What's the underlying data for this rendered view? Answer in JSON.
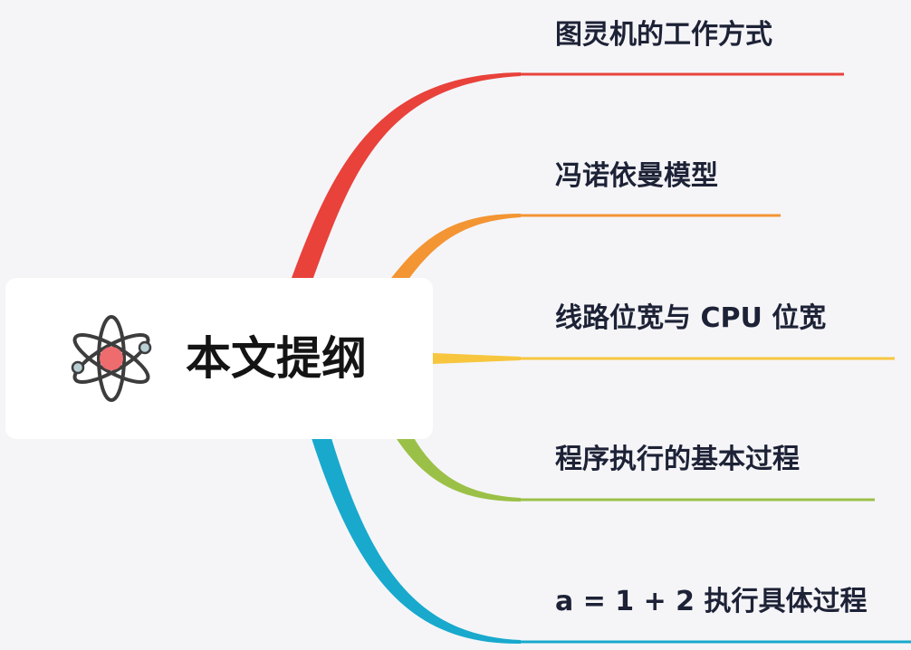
{
  "root": {
    "title": "本文提纲",
    "icon": "atom-icon"
  },
  "topics": [
    {
      "label": "图灵机的工作方式",
      "color": "#e8423b"
    },
    {
      "label": "冯诺依曼模型",
      "color": "#f39533"
    },
    {
      "label": "线路位宽与 CPU 位宽",
      "color": "#f7c63e"
    },
    {
      "label": "程序执行的基本过程",
      "color": "#9bc047"
    },
    {
      "label": "a = 1 + 2 执行具体过程",
      "color": "#18a9cd"
    }
  ]
}
